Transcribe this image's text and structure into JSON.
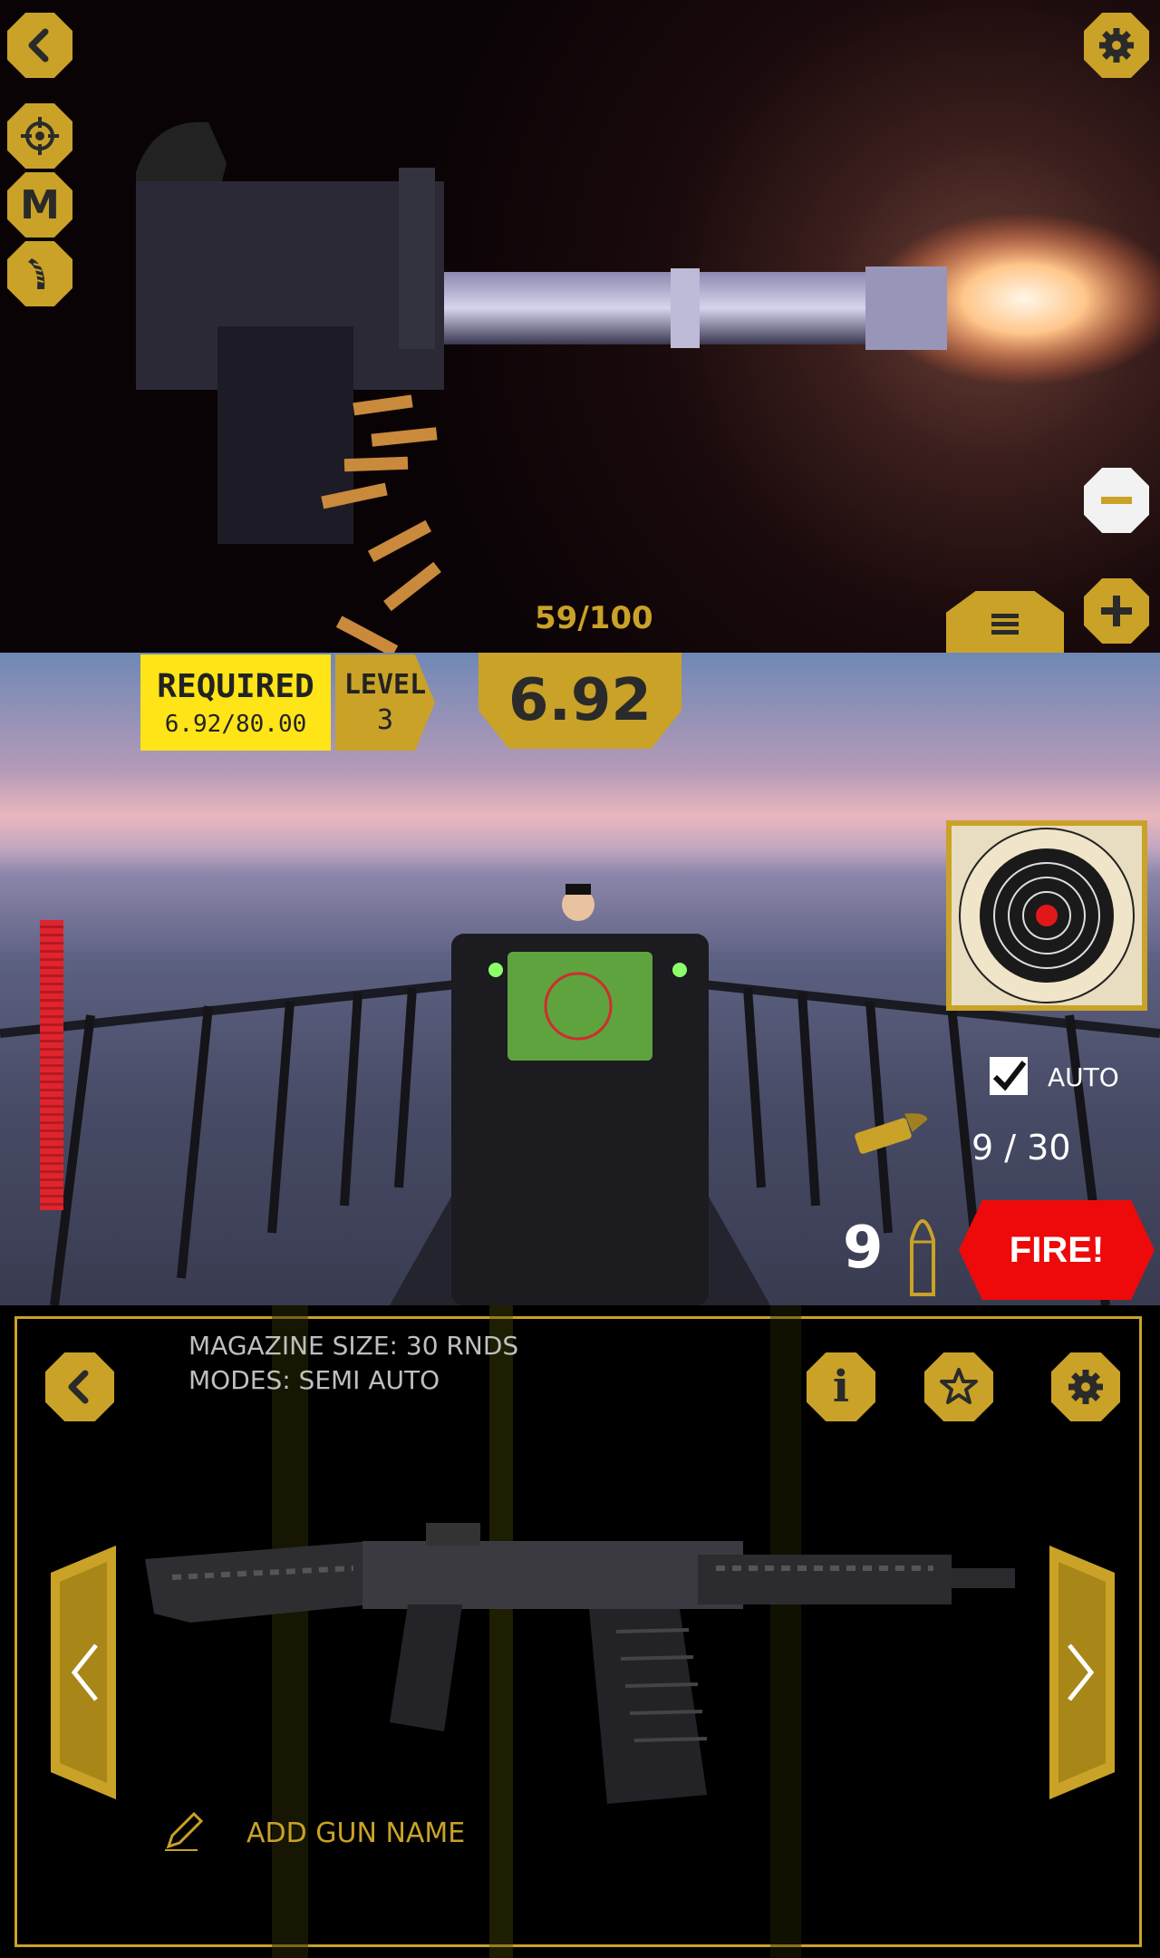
{
  "top": {
    "ammo_counter": "59/100",
    "buttons": [
      "back-icon",
      "crosshair-icon",
      "mode-icon",
      "magazine-icon",
      "gear-icon",
      "minus-icon",
      "plus-icon",
      "menu-icon"
    ],
    "mode_letter": "M"
  },
  "hud": {
    "required_label": "REQUIRED",
    "required_value": "6.92/80.00",
    "level_label": "LEVEL",
    "level_value": "3",
    "score": "6.92",
    "auto_label": "AUTO",
    "auto_checked": true,
    "mag_count": "9 / 30",
    "rounds_left": "9",
    "fire_label": "FIRE!"
  },
  "gun_panel": {
    "magazine_size": "MAGAZINE SIZE: 30 RNDS",
    "modes": "MODES: SEMI AUTO",
    "add_name": "ADD GUN NAME",
    "info_glyph": "i"
  },
  "colors": {
    "accent_gold": "#c9a227",
    "required_yellow": "#ffe417",
    "fire_red": "#ee0a0a"
  }
}
